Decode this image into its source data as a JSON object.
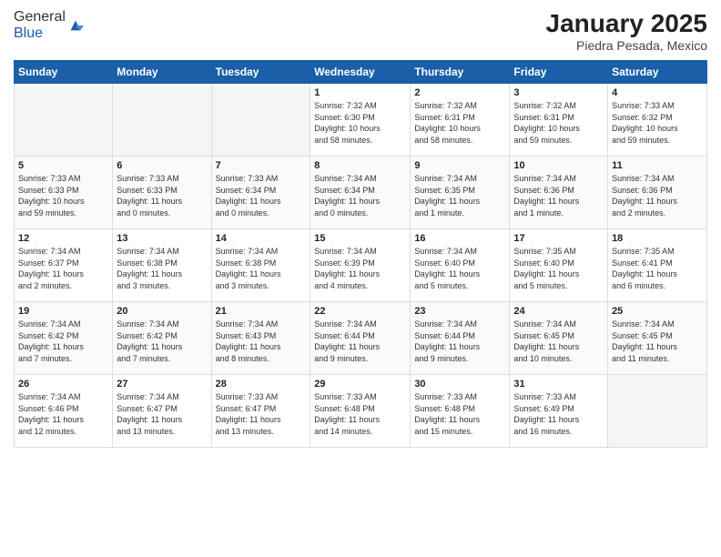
{
  "header": {
    "title": "January 2025",
    "subtitle": "Piedra Pesada, Mexico"
  },
  "days": [
    "Sunday",
    "Monday",
    "Tuesday",
    "Wednesday",
    "Thursday",
    "Friday",
    "Saturday"
  ],
  "weeks": [
    [
      {
        "num": "",
        "info": ""
      },
      {
        "num": "",
        "info": ""
      },
      {
        "num": "",
        "info": ""
      },
      {
        "num": "1",
        "info": "Sunrise: 7:32 AM\nSunset: 6:30 PM\nDaylight: 10 hours\nand 58 minutes."
      },
      {
        "num": "2",
        "info": "Sunrise: 7:32 AM\nSunset: 6:31 PM\nDaylight: 10 hours\nand 58 minutes."
      },
      {
        "num": "3",
        "info": "Sunrise: 7:32 AM\nSunset: 6:31 PM\nDaylight: 10 hours\nand 59 minutes."
      },
      {
        "num": "4",
        "info": "Sunrise: 7:33 AM\nSunset: 6:32 PM\nDaylight: 10 hours\nand 59 minutes."
      }
    ],
    [
      {
        "num": "5",
        "info": "Sunrise: 7:33 AM\nSunset: 6:33 PM\nDaylight: 10 hours\nand 59 minutes."
      },
      {
        "num": "6",
        "info": "Sunrise: 7:33 AM\nSunset: 6:33 PM\nDaylight: 11 hours\nand 0 minutes."
      },
      {
        "num": "7",
        "info": "Sunrise: 7:33 AM\nSunset: 6:34 PM\nDaylight: 11 hours\nand 0 minutes."
      },
      {
        "num": "8",
        "info": "Sunrise: 7:34 AM\nSunset: 6:34 PM\nDaylight: 11 hours\nand 0 minutes."
      },
      {
        "num": "9",
        "info": "Sunrise: 7:34 AM\nSunset: 6:35 PM\nDaylight: 11 hours\nand 1 minute."
      },
      {
        "num": "10",
        "info": "Sunrise: 7:34 AM\nSunset: 6:36 PM\nDaylight: 11 hours\nand 1 minute."
      },
      {
        "num": "11",
        "info": "Sunrise: 7:34 AM\nSunset: 6:36 PM\nDaylight: 11 hours\nand 2 minutes."
      }
    ],
    [
      {
        "num": "12",
        "info": "Sunrise: 7:34 AM\nSunset: 6:37 PM\nDaylight: 11 hours\nand 2 minutes."
      },
      {
        "num": "13",
        "info": "Sunrise: 7:34 AM\nSunset: 6:38 PM\nDaylight: 11 hours\nand 3 minutes."
      },
      {
        "num": "14",
        "info": "Sunrise: 7:34 AM\nSunset: 6:38 PM\nDaylight: 11 hours\nand 3 minutes."
      },
      {
        "num": "15",
        "info": "Sunrise: 7:34 AM\nSunset: 6:39 PM\nDaylight: 11 hours\nand 4 minutes."
      },
      {
        "num": "16",
        "info": "Sunrise: 7:34 AM\nSunset: 6:40 PM\nDaylight: 11 hours\nand 5 minutes."
      },
      {
        "num": "17",
        "info": "Sunrise: 7:35 AM\nSunset: 6:40 PM\nDaylight: 11 hours\nand 5 minutes."
      },
      {
        "num": "18",
        "info": "Sunrise: 7:35 AM\nSunset: 6:41 PM\nDaylight: 11 hours\nand 6 minutes."
      }
    ],
    [
      {
        "num": "19",
        "info": "Sunrise: 7:34 AM\nSunset: 6:42 PM\nDaylight: 11 hours\nand 7 minutes."
      },
      {
        "num": "20",
        "info": "Sunrise: 7:34 AM\nSunset: 6:42 PM\nDaylight: 11 hours\nand 7 minutes."
      },
      {
        "num": "21",
        "info": "Sunrise: 7:34 AM\nSunset: 6:43 PM\nDaylight: 11 hours\nand 8 minutes."
      },
      {
        "num": "22",
        "info": "Sunrise: 7:34 AM\nSunset: 6:44 PM\nDaylight: 11 hours\nand 9 minutes."
      },
      {
        "num": "23",
        "info": "Sunrise: 7:34 AM\nSunset: 6:44 PM\nDaylight: 11 hours\nand 9 minutes."
      },
      {
        "num": "24",
        "info": "Sunrise: 7:34 AM\nSunset: 6:45 PM\nDaylight: 11 hours\nand 10 minutes."
      },
      {
        "num": "25",
        "info": "Sunrise: 7:34 AM\nSunset: 6:45 PM\nDaylight: 11 hours\nand 11 minutes."
      }
    ],
    [
      {
        "num": "26",
        "info": "Sunrise: 7:34 AM\nSunset: 6:46 PM\nDaylight: 11 hours\nand 12 minutes."
      },
      {
        "num": "27",
        "info": "Sunrise: 7:34 AM\nSunset: 6:47 PM\nDaylight: 11 hours\nand 13 minutes."
      },
      {
        "num": "28",
        "info": "Sunrise: 7:33 AM\nSunset: 6:47 PM\nDaylight: 11 hours\nand 13 minutes."
      },
      {
        "num": "29",
        "info": "Sunrise: 7:33 AM\nSunset: 6:48 PM\nDaylight: 11 hours\nand 14 minutes."
      },
      {
        "num": "30",
        "info": "Sunrise: 7:33 AM\nSunset: 6:48 PM\nDaylight: 11 hours\nand 15 minutes."
      },
      {
        "num": "31",
        "info": "Sunrise: 7:33 AM\nSunset: 6:49 PM\nDaylight: 11 hours\nand 16 minutes."
      },
      {
        "num": "",
        "info": ""
      }
    ]
  ]
}
